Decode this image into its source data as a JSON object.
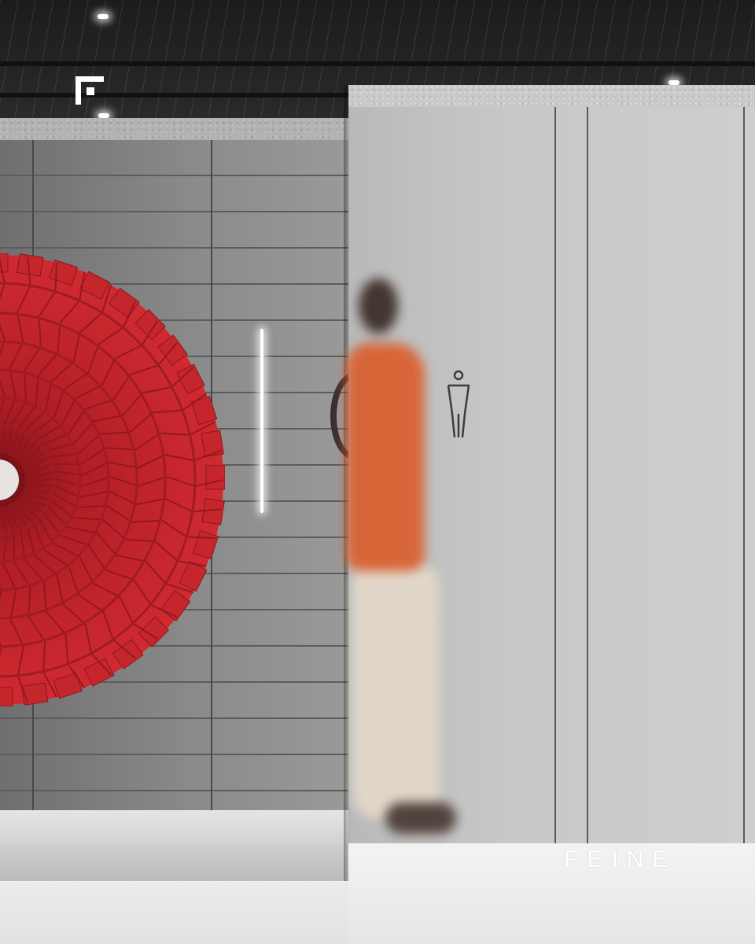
{
  "watermark": {
    "brand_text": "FEINE",
    "brand_color": "#ffffff",
    "logo_icon": "corner-bracket-logo-icon"
  },
  "scene": {
    "sculpture_color": "#c4262c",
    "person_shirt_color": "#d9602f",
    "restroom_sign_icon": "male-restroom-icon"
  }
}
